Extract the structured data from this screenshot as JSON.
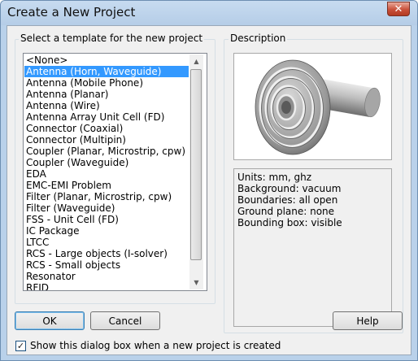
{
  "window": {
    "title": "Create a New Project",
    "close_glyph": "✕"
  },
  "templates": {
    "label": "Select a template for the new project",
    "selected_index": 1,
    "items": [
      "<None>",
      "Antenna (Horn, Waveguide)",
      "Antenna (Mobile Phone)",
      "Antenna (Planar)",
      "Antenna (Wire)",
      "Antenna Array Unit Cell (FD)",
      "Connector (Coaxial)",
      "Connector (Multipin)",
      "Coupler (Planar, Microstrip, cpw)",
      "Coupler (Waveguide)",
      "EDA",
      "EMC-EMI Problem",
      "Filter (Planar, Microstrip, cpw)",
      "Filter (Waveguide)",
      "FSS - Unit Cell (FD)",
      "IC Package",
      "LTCC",
      "RCS - Large objects (I-solver)",
      "RCS - Small objects",
      "Resonator",
      "RFID"
    ],
    "scroll_up_glyph": "▲",
    "scroll_down_glyph": "▼"
  },
  "description": {
    "label": "Description",
    "preview_icon": "horn-antenna-preview",
    "lines": [
      "Units: mm, ghz",
      "Background: vacuum",
      "Boundaries: all open",
      "Ground plane: none",
      "Bounding box: visible"
    ]
  },
  "buttons": {
    "ok": "OK",
    "cancel": "Cancel",
    "help": "Help"
  },
  "show_dialog": {
    "label": "Show this dialog box when a new project is created",
    "checked": true,
    "check_glyph": "✓"
  },
  "colors": {
    "selection": "#3399ff",
    "frame": "#b9d1ea"
  }
}
